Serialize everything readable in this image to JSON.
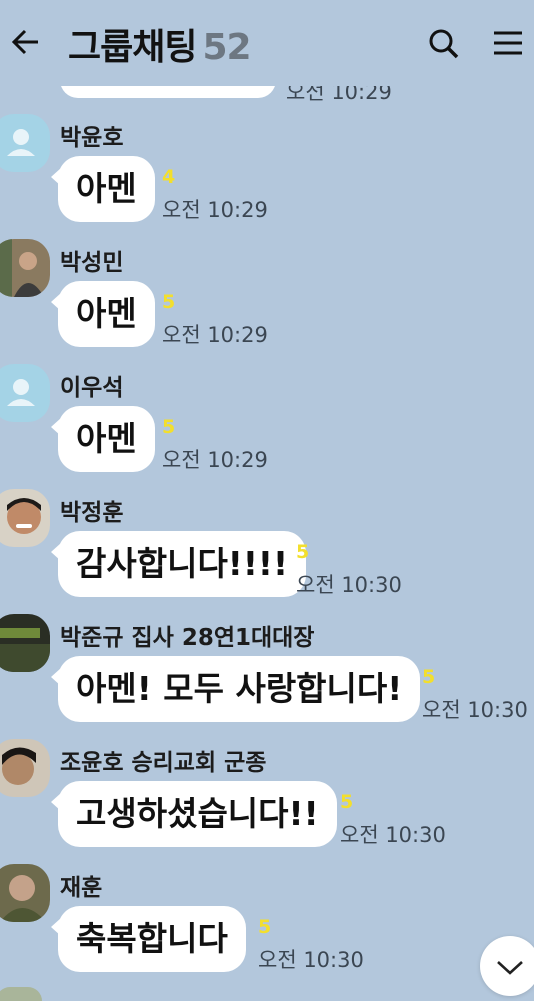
{
  "header": {
    "title": "그룹채팅",
    "member_count": "52",
    "icons": [
      "arrow-left-icon",
      "search-icon",
      "menu-icon"
    ]
  },
  "clipped_previous": {
    "time": "오전 10:29"
  },
  "messages": [
    {
      "sender": "박윤호",
      "text": "아멘",
      "unread": "4",
      "time": "오전 10:29",
      "avatar": "default-profile"
    },
    {
      "sender": "박성민",
      "text": "아멘",
      "unread": "5",
      "time": "오전 10:29",
      "avatar": "photo"
    },
    {
      "sender": "이우석",
      "text": "아멘",
      "unread": "5",
      "time": "오전 10:29",
      "avatar": "default-profile"
    },
    {
      "sender": "박정훈",
      "text": "감사합니다!!!!",
      "unread": "5",
      "time": "오전 10:30",
      "avatar": "photo"
    },
    {
      "sender": "박준규 집사 28연1대대장",
      "text": "아멘! 모두 사랑합니다!",
      "unread": "5",
      "time": "오전 10:30",
      "avatar": "photo"
    },
    {
      "sender": "조윤호 승리교회 군종",
      "text": "고생하셨습니다!!",
      "unread": "5",
      "time": "오전 10:30",
      "avatar": "photo"
    },
    {
      "sender": "재훈",
      "text": "축복합니다",
      "unread": "5",
      "time": "오전 10:30",
      "avatar": "photo"
    }
  ],
  "colors": {
    "background": "#b3c7dc",
    "bubble": "#ffffff",
    "unread": "#f3df2c",
    "time": "#3b4652",
    "default_avatar": "#a4d3e6"
  }
}
